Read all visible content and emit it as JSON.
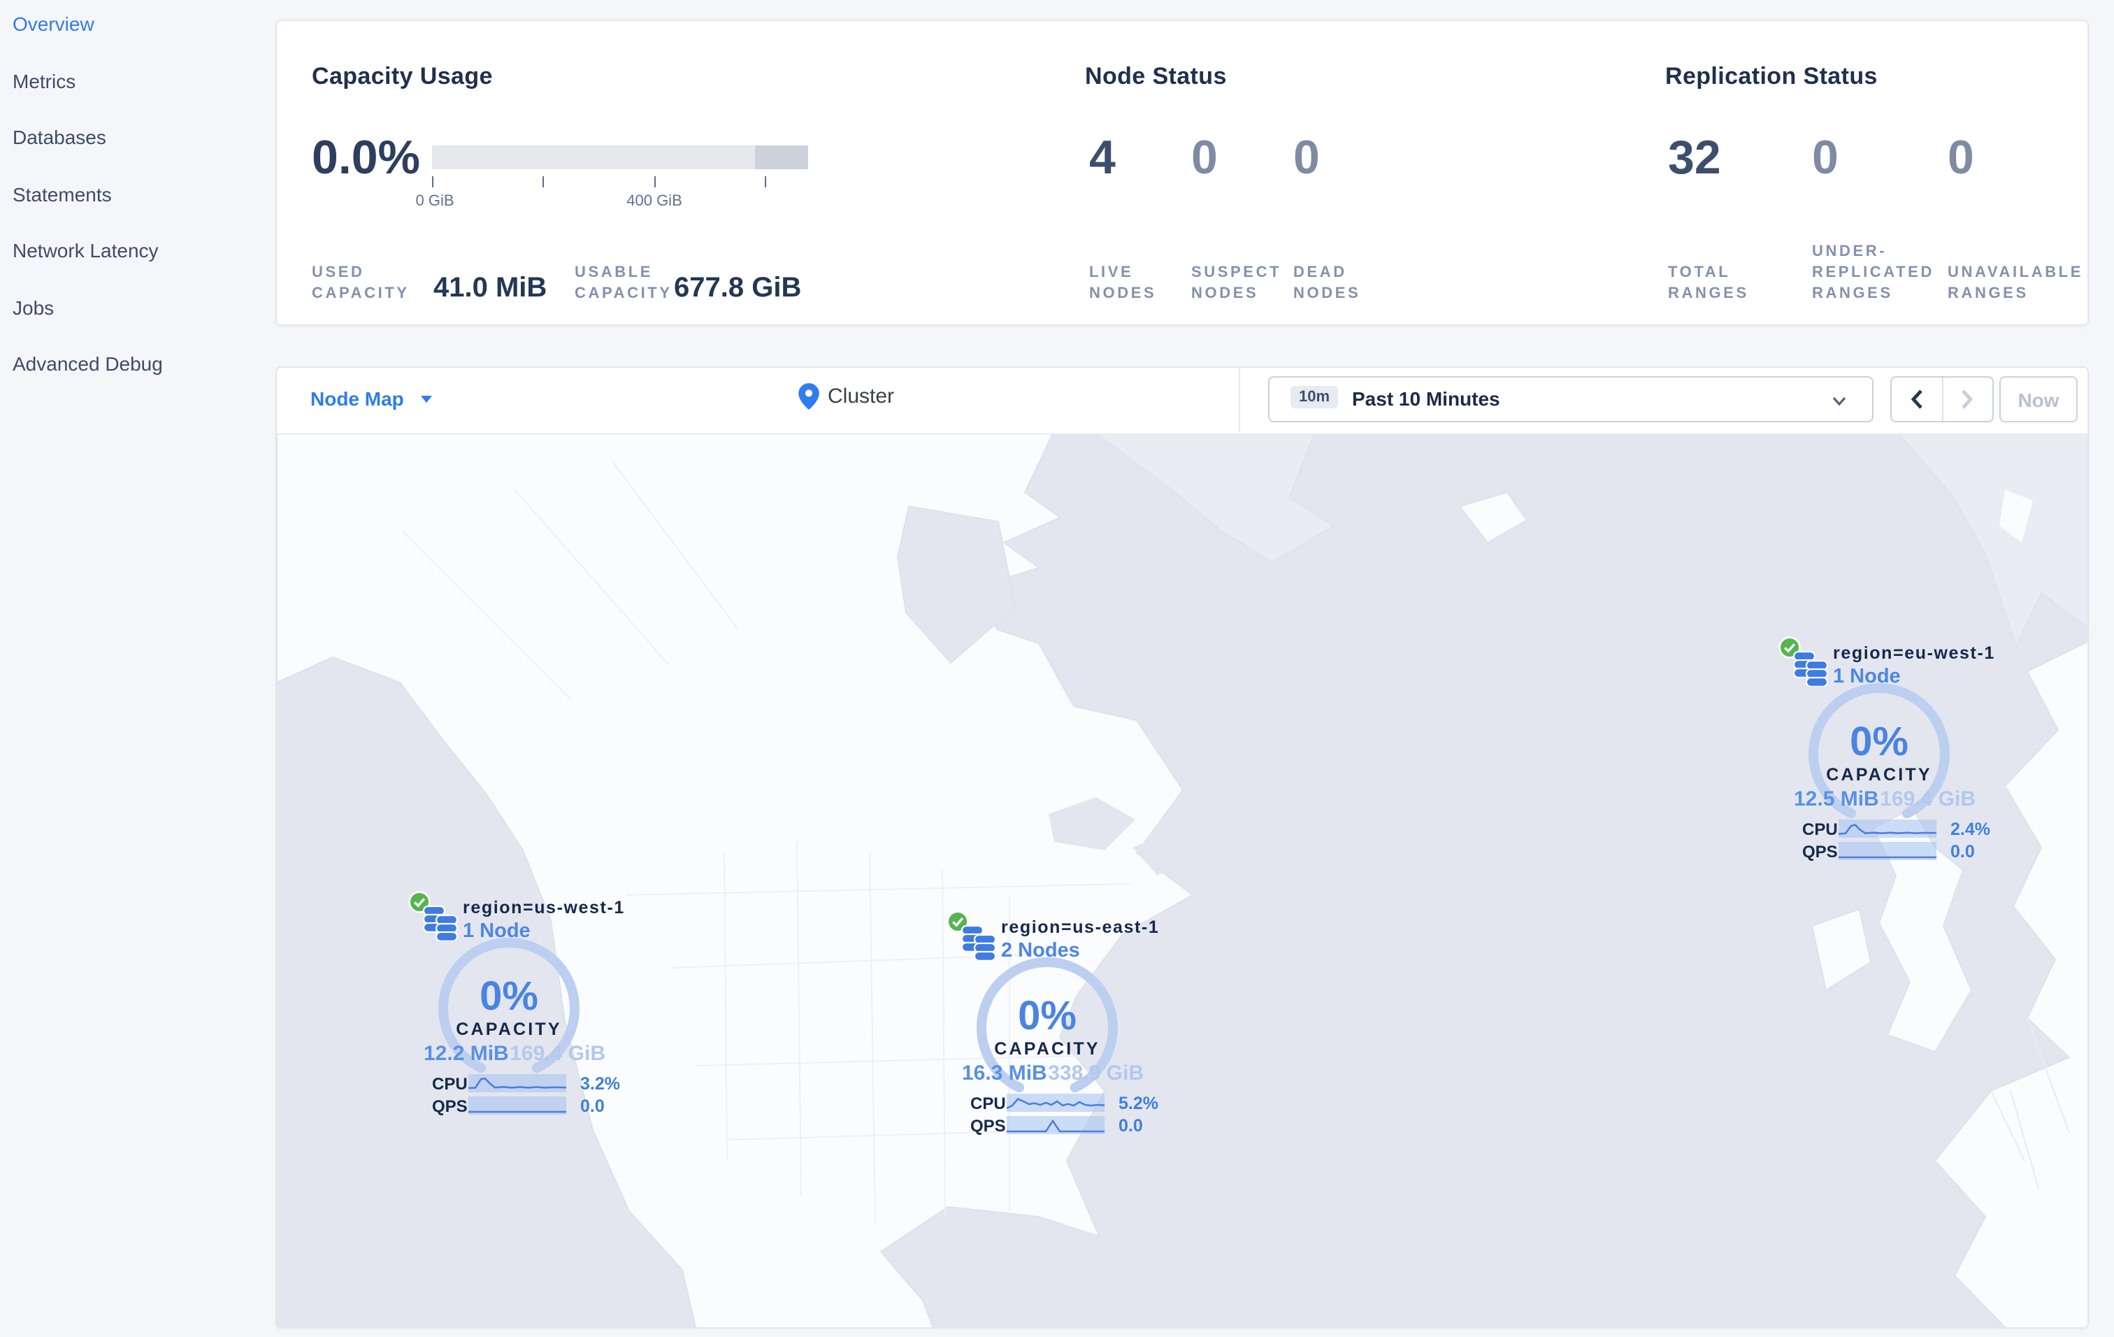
{
  "sidebar": {
    "items": [
      {
        "label": "Overview",
        "active": true
      },
      {
        "label": "Metrics",
        "active": false
      },
      {
        "label": "Databases",
        "active": false
      },
      {
        "label": "Statements",
        "active": false
      },
      {
        "label": "Network Latency",
        "active": false
      },
      {
        "label": "Jobs",
        "active": false
      },
      {
        "label": "Advanced Debug",
        "active": false
      }
    ]
  },
  "stats": {
    "capacity": {
      "title": "Capacity Usage",
      "percent": "0.0%",
      "tick_label_zero": "0 GiB",
      "tick_label_mid": "400 GiB",
      "used_label": "USED CAPACITY",
      "used_value": "41.0 MiB",
      "usable_label": "USABLE CAPACITY",
      "usable_value": "677.8 GiB"
    },
    "nodes": {
      "title": "Node Status",
      "live_value": "4",
      "live_label": "LIVE NODES",
      "suspect_value": "0",
      "suspect_label": "SUSPECT NODES",
      "dead_value": "0",
      "dead_label": "DEAD NODES"
    },
    "replication": {
      "title": "Replication Status",
      "total_value": "32",
      "total_label": "TOTAL RANGES",
      "under_value": "0",
      "under_label": "UNDER-REPLICATED RANGES",
      "unavailable_value": "0",
      "unavailable_label": "UNAVAILABLE RANGES"
    }
  },
  "toolbar": {
    "view_dropdown": "Node Map",
    "breadcrumb": "Cluster",
    "time_badge": "10m",
    "time_range": "Past 10 Minutes",
    "now_button": "Now"
  },
  "markers": [
    {
      "region": "region=us-west-1",
      "nodes": "1 Node",
      "capacity_percent": "0%",
      "capacity_label": "CAPACITY",
      "used": "12.2 MiB",
      "capacity_total": "169.4 GiB",
      "cpu_label": "CPU",
      "cpu_value": "3.2%",
      "qps_label": "QPS",
      "qps_value": "0.0"
    },
    {
      "region": "region=us-east-1",
      "nodes": "2 Nodes",
      "capacity_percent": "0%",
      "capacity_label": "CAPACITY",
      "used": "16.3 MiB",
      "capacity_total": "338.9 GiB",
      "cpu_label": "CPU",
      "cpu_value": "5.2%",
      "qps_label": "QPS",
      "qps_value": "0.0"
    },
    {
      "region": "region=eu-west-1",
      "nodes": "1 Node",
      "capacity_percent": "0%",
      "capacity_label": "CAPACITY",
      "used": "12.5 MiB",
      "capacity_total": "169.4 GiB",
      "cpu_label": "CPU",
      "cpu_value": "2.4%",
      "qps_label": "QPS",
      "qps_value": "0.0"
    }
  ],
  "colors": {
    "accent": "#2e7cf0",
    "node_link_blue": "#4c86e8",
    "gauge_arc": "#bccff0",
    "ocean": "#e3e6ee",
    "land": "#fbfcfe",
    "green_check": "#55b54f"
  }
}
